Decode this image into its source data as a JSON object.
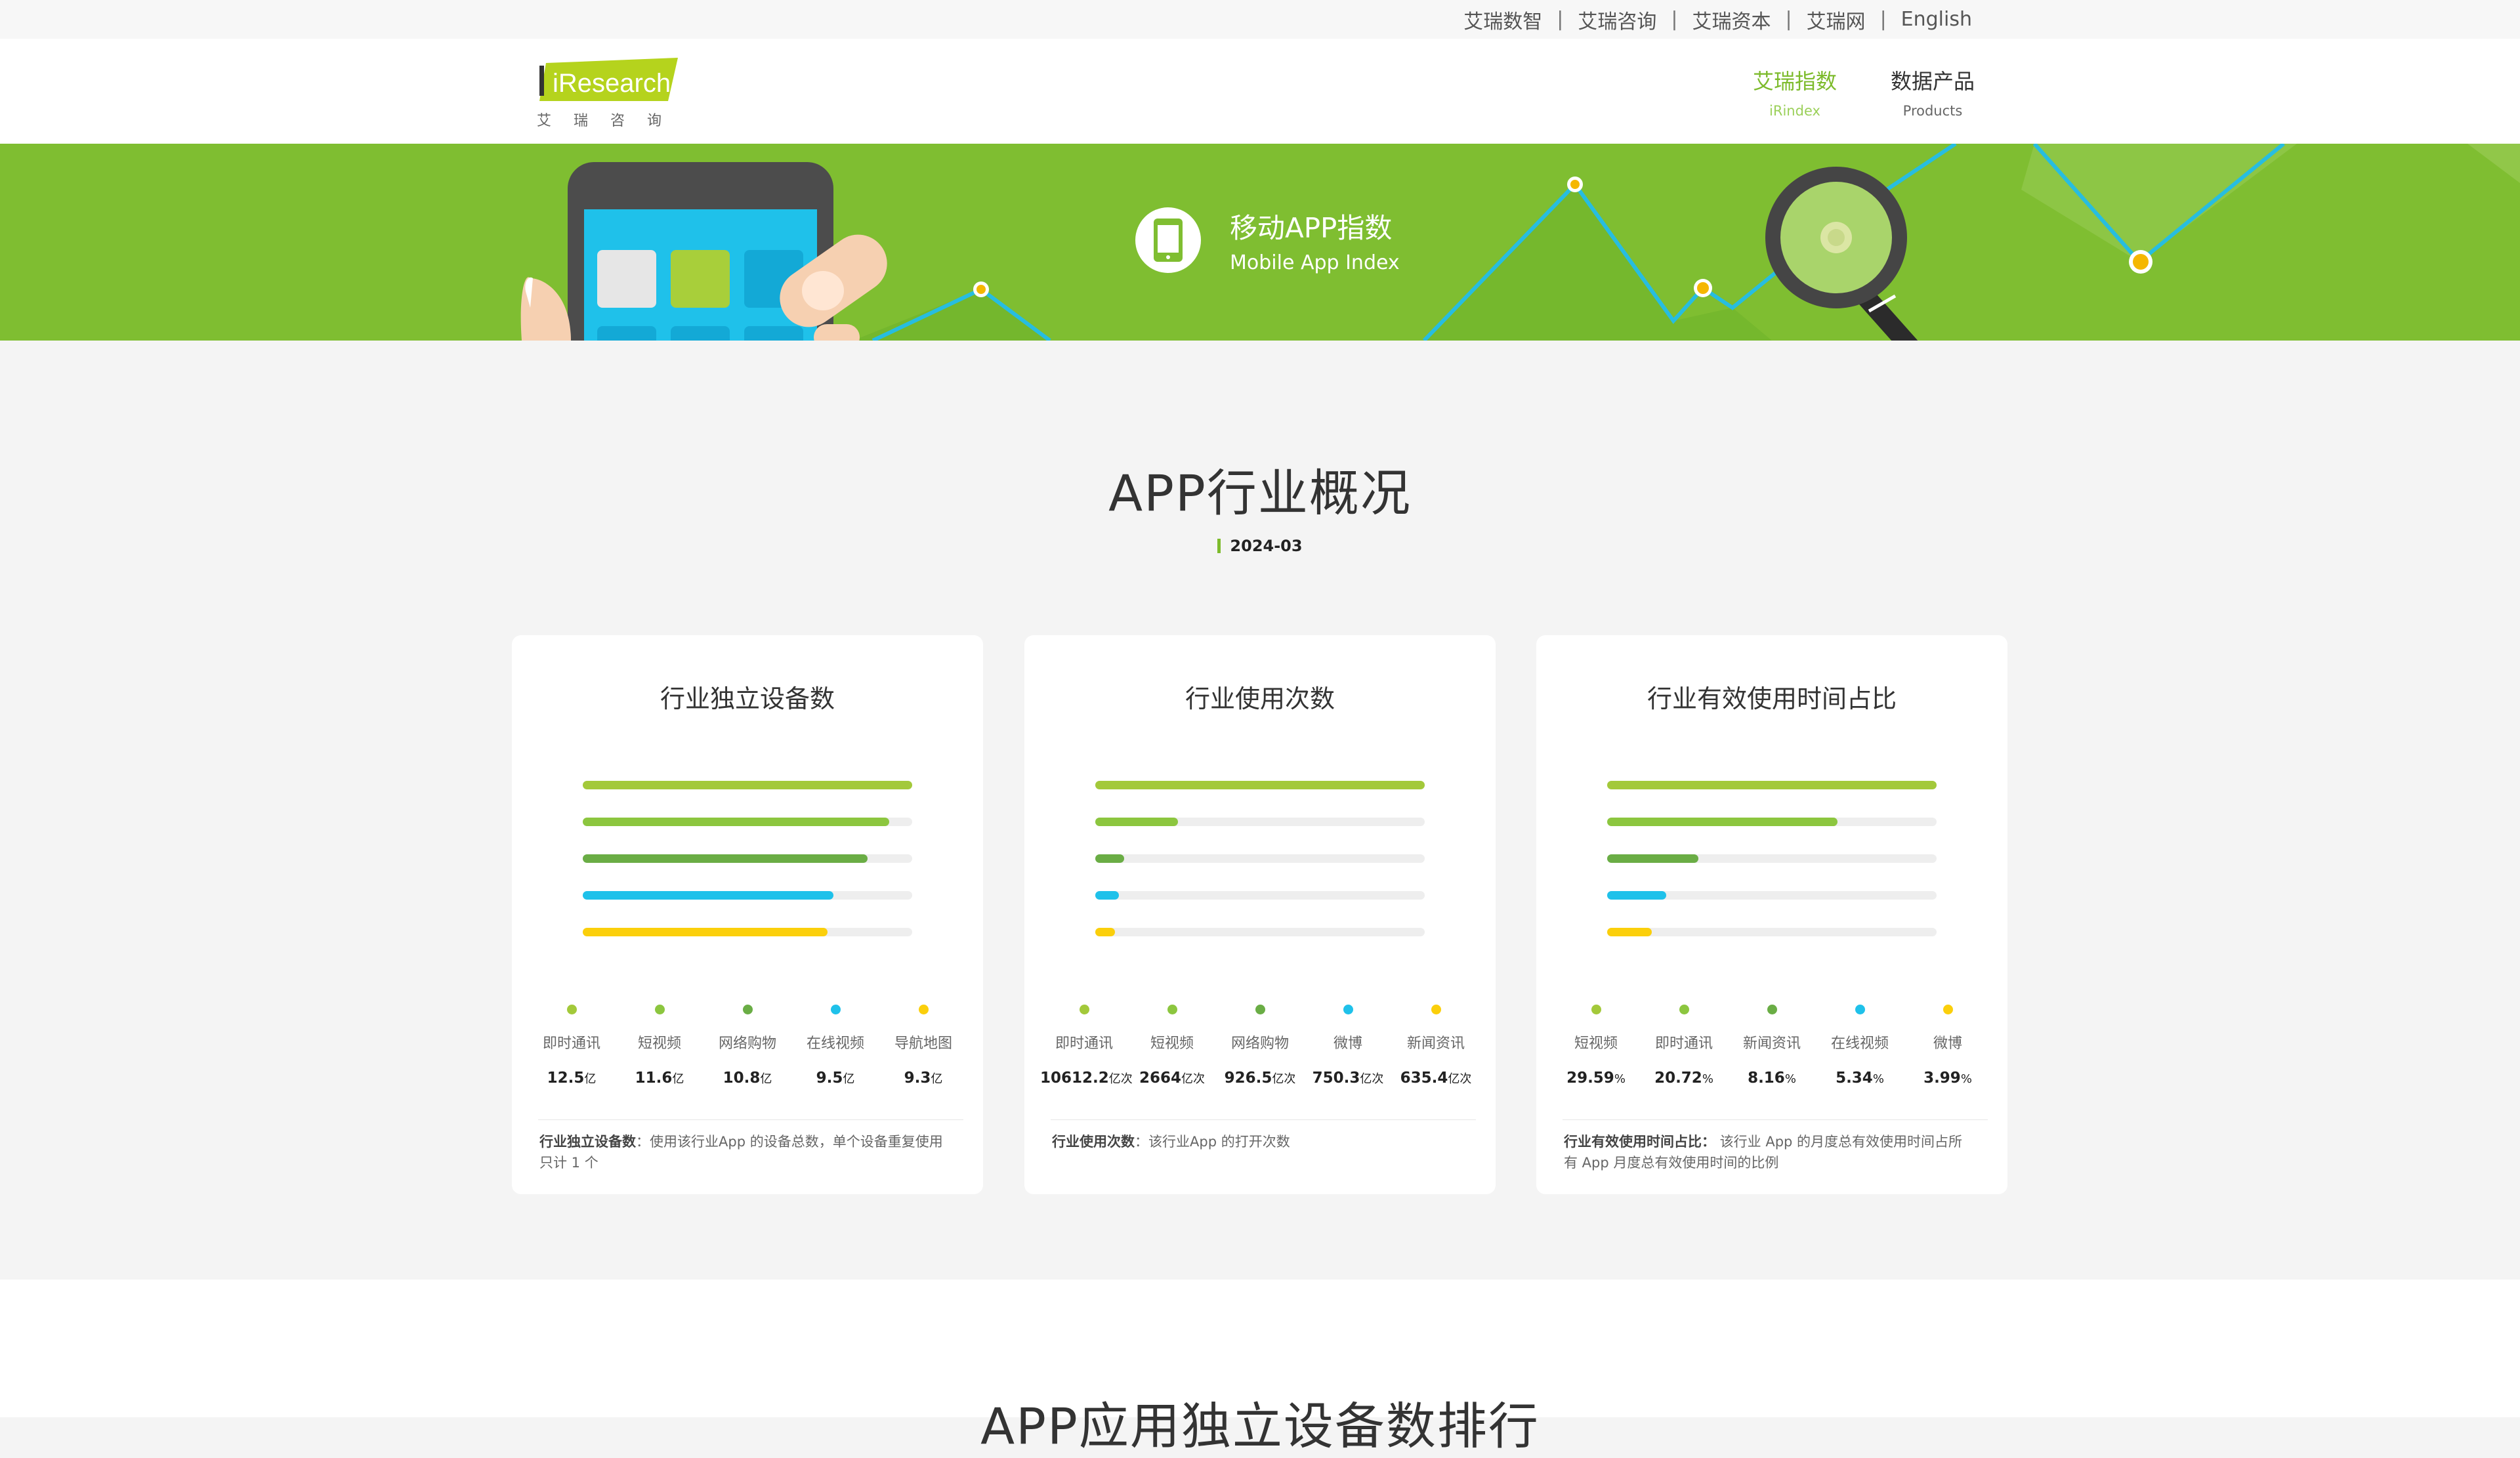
{
  "top_links": [
    "艾瑞数智",
    "艾瑞咨询",
    "艾瑞资本",
    "艾瑞网",
    "English"
  ],
  "logo": {
    "text": "iResearch",
    "sub": "艾瑞咨询"
  },
  "nav": [
    {
      "cn": "艾瑞指数",
      "en": "iRindex",
      "active": true
    },
    {
      "cn": "数据产品",
      "en": "Products",
      "active": false
    }
  ],
  "banner": {
    "title_cn": "移动APP指数",
    "title_en": "Mobile App Index",
    "icon": "phone-icon"
  },
  "overview": {
    "title": "APP行业概况",
    "date": "2024-03",
    "cards": [
      {
        "title": "行业独立设备数",
        "items": [
          {
            "name": "即时通讯",
            "value": "12.5",
            "unit": "亿",
            "level": 1.0,
            "color": "#a3c93a"
          },
          {
            "name": "短视频",
            "value": "11.6",
            "unit": "亿",
            "level": 0.93,
            "color": "#8cc63f"
          },
          {
            "name": "网络购物",
            "value": "10.8",
            "unit": "亿",
            "level": 0.864,
            "color": "#6aad45"
          },
          {
            "name": "在线视频",
            "value": "9.5",
            "unit": "亿",
            "level": 0.76,
            "color": "#1fc1ea"
          },
          {
            "name": "导航地图",
            "value": "9.3",
            "unit": "亿",
            "level": 0.744,
            "color": "#fbcf0b"
          }
        ],
        "note_label": "行业独立设备数",
        "note_text": "：使用该行业App 的设备总数，单个设备重复使用只计 1 个"
      },
      {
        "title": "行业使用次数",
        "items": [
          {
            "name": "即时通讯",
            "value": "10612.2",
            "unit": "亿次",
            "level": 1.0,
            "color": "#a3c93a"
          },
          {
            "name": "短视频",
            "value": "2664",
            "unit": "亿次",
            "level": 0.251,
            "color": "#8cc63f"
          },
          {
            "name": "网络购物",
            "value": "926.5",
            "unit": "亿次",
            "level": 0.087,
            "color": "#6aad45"
          },
          {
            "name": "微博",
            "value": "750.3",
            "unit": "亿次",
            "level": 0.071,
            "color": "#1fc1ea"
          },
          {
            "name": "新闻资讯",
            "value": "635.4",
            "unit": "亿次",
            "level": 0.06,
            "color": "#fbcf0b"
          }
        ],
        "note_label": "行业使用次数",
        "note_text": "：该行业App 的打开次数"
      },
      {
        "title": "行业有效使用时间占比",
        "items": [
          {
            "name": "短视频",
            "value": "29.59",
            "unit": "%",
            "level": 1.0,
            "color": "#a3c93a"
          },
          {
            "name": "即时通讯",
            "value": "20.72",
            "unit": "%",
            "level": 0.7,
            "color": "#8cc63f"
          },
          {
            "name": "新闻资讯",
            "value": "8.16",
            "unit": "%",
            "level": 0.276,
            "color": "#6aad45"
          },
          {
            "name": "在线视频",
            "value": "5.34",
            "unit": "%",
            "level": 0.18,
            "color": "#1fc1ea"
          },
          {
            "name": "微博",
            "value": "3.99",
            "unit": "%",
            "level": 0.135,
            "color": "#fbcf0b"
          }
        ],
        "note_label": "行业有效使用时间占比：",
        "note_text": " 该行业 App 的月度总有效使用时间占所有 App 月度总有效使用时间的比例"
      }
    ]
  },
  "next_section": {
    "title": "APP应用独立设备数排行"
  },
  "colors": {
    "brand_green": "#7dbb2c",
    "banner_green": "#7fbe31",
    "accent_blue": "#1fc1ea",
    "accent_yellow": "#fbcf0b"
  }
}
